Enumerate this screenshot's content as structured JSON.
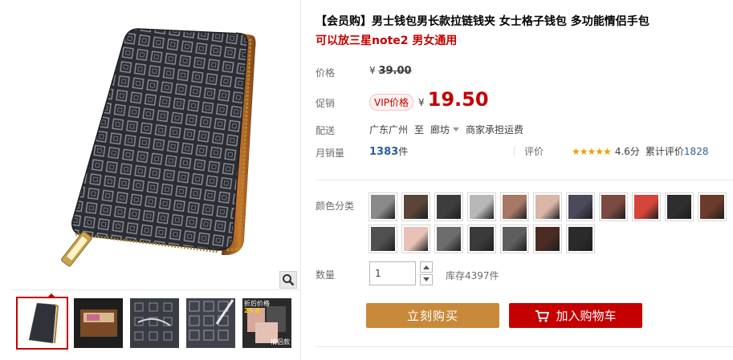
{
  "product": {
    "title": "【会员购】男士钱包男长款拉链钱夹 女士格子钱包 多功能情侣手包",
    "subtitle": "可以放三星note2 男女通用"
  },
  "price": {
    "label": "价格",
    "currency": "¥",
    "original": "39.00"
  },
  "promo": {
    "label": "促销",
    "vip_badge": "VIP价格",
    "currency": "¥",
    "price": "19.50"
  },
  "shipping": {
    "label": "配送",
    "from": "广东广州",
    "to_word": "至",
    "destination": "廊坊",
    "fee_note": "商家承担运费"
  },
  "sales": {
    "label": "月销量",
    "count": "1383",
    "unit": "件"
  },
  "review": {
    "label": "评价",
    "stars": "★★★★★",
    "score": "4.6分",
    "total_label": "累计评价",
    "total": "1828"
  },
  "color": {
    "label": "颜色分类",
    "swatch_colors": [
      "#8a8a8a",
      "#5a4538",
      "#3d3d3d",
      "#b8b8b8",
      "#a87866",
      "#d9b6a8",
      "#4a4a5a",
      "#7b4a40",
      "#d6453a",
      "#2e2e2e",
      "#6a3a2a",
      "#505050",
      "#e8c2b6",
      "#6d6d6d",
      "#3a3a3a",
      "#5e5e5e",
      "#4a2c22",
      "#2a2a2a"
    ]
  },
  "quantity": {
    "label": "数量",
    "value": "1",
    "stock": "库存4397件"
  },
  "actions": {
    "buy": "立刻购买",
    "cart": "加入购物车"
  },
  "thumbs": [
    {
      "name": "thumb-1"
    },
    {
      "name": "thumb-2"
    },
    {
      "name": "thumb-3"
    },
    {
      "name": "thumb-4"
    },
    {
      "name": "thumb-5"
    }
  ],
  "thumb5_caption": {
    "top": "折后价格",
    "price": "29.8",
    "bottom": "情侣款"
  },
  "colors": {
    "accent_red": "#c40000",
    "buy_button": "#c8893a",
    "link_blue": "#2b5d9b"
  }
}
